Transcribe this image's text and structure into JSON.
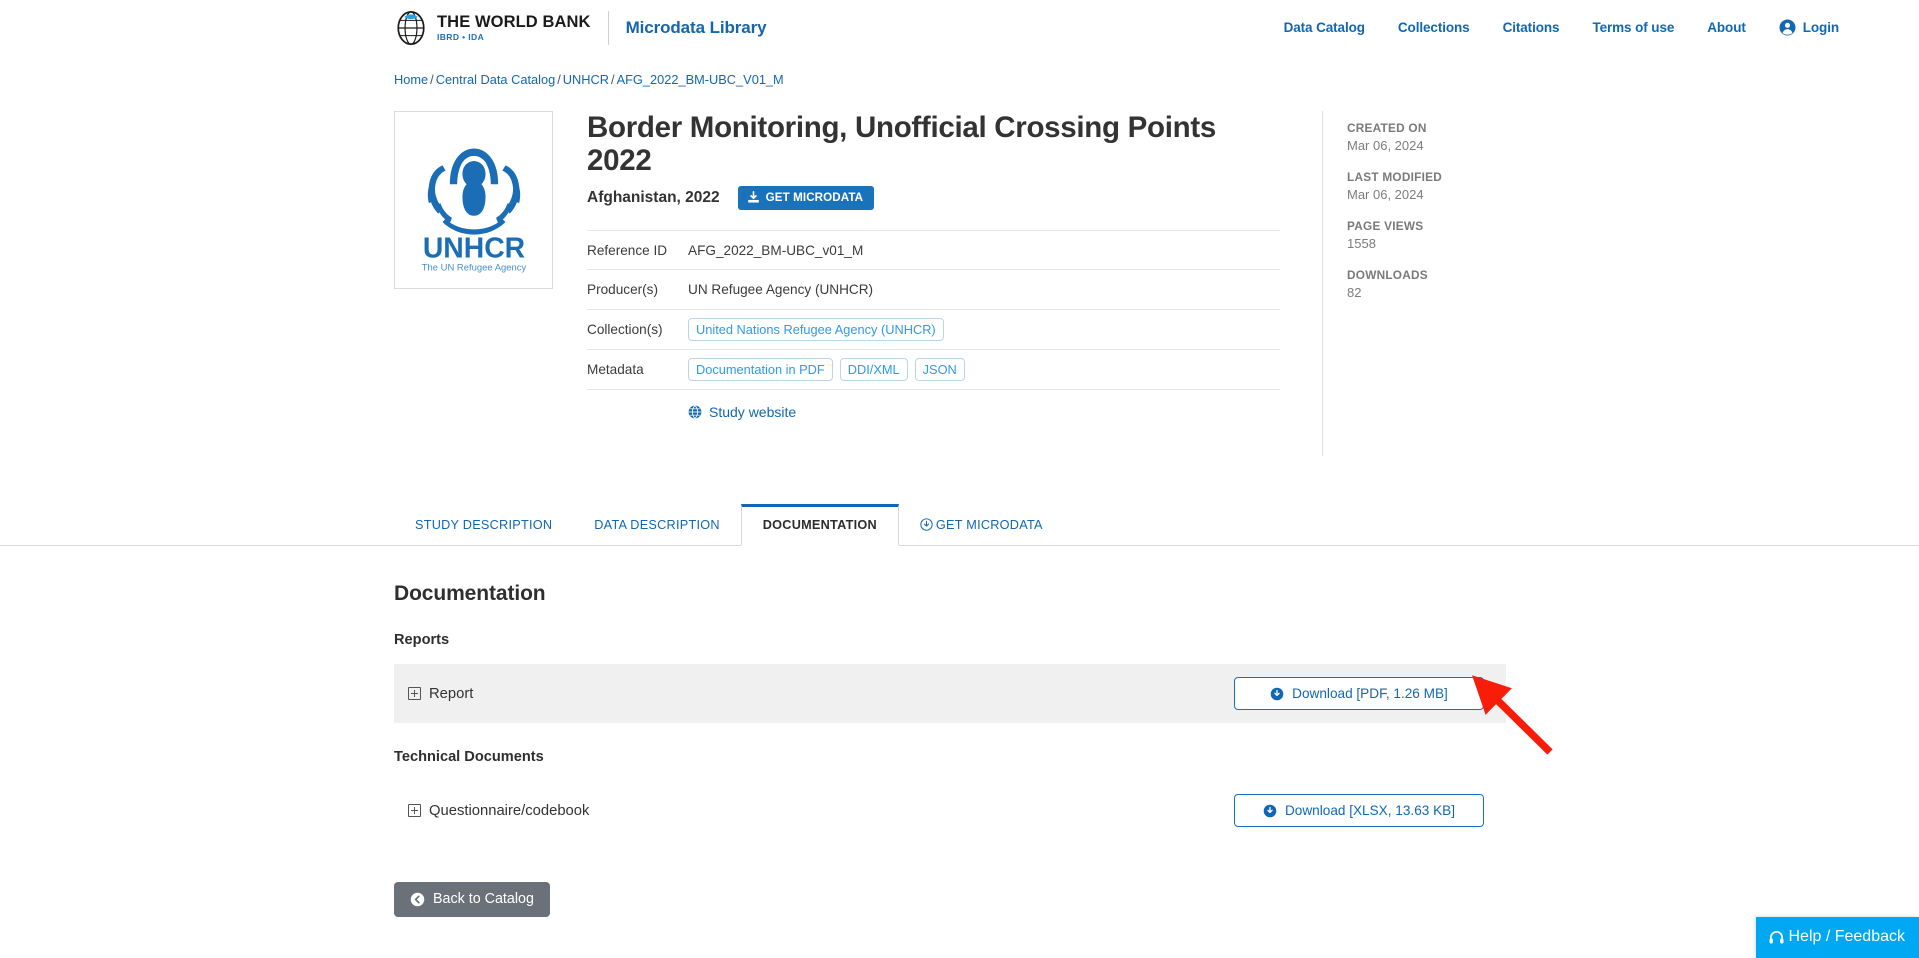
{
  "header": {
    "brand_title": "THE WORLD BANK",
    "brand_subtitle": "IBRD • IDA",
    "app_name": "Microdata Library",
    "nav": [
      {
        "label": "Data Catalog"
      },
      {
        "label": "Collections"
      },
      {
        "label": "Citations"
      },
      {
        "label": "Terms of use"
      },
      {
        "label": "About"
      }
    ],
    "login_label": "Login"
  },
  "breadcrumb": {
    "items": [
      {
        "label": "Home"
      },
      {
        "label": "Central Data Catalog"
      },
      {
        "label": "UNHCR"
      },
      {
        "label": "AFG_2022_BM-UBC_V01_M"
      }
    ],
    "separator": "/"
  },
  "study": {
    "logo_name": "UNHCR",
    "logo_tagline": "The UN Refugee Agency",
    "title": "Border Monitoring, Unofficial Crossing Points 2022",
    "country_year": "Afghanistan, 2022",
    "get_microdata_label": "GET MICRODATA",
    "metadata_rows": [
      {
        "label": "Reference ID",
        "type": "text",
        "value": "AFG_2022_BM-UBC_v01_M"
      },
      {
        "label": "Producer(s)",
        "type": "text",
        "value": "UN Refugee Agency (UNHCR)"
      },
      {
        "label": "Collection(s)",
        "type": "pills",
        "pills": [
          "United Nations Refugee Agency (UNHCR)"
        ]
      },
      {
        "label": "Metadata",
        "type": "pills",
        "pills": [
          "Documentation in PDF",
          "DDI/XML",
          "JSON"
        ]
      }
    ],
    "study_website_label": "Study website"
  },
  "stats": [
    {
      "label": "CREATED ON",
      "value": "Mar 06, 2024"
    },
    {
      "label": "LAST MODIFIED",
      "value": "Mar 06, 2024"
    },
    {
      "label": "PAGE VIEWS",
      "value": "1558"
    },
    {
      "label": "DOWNLOADS",
      "value": "82"
    }
  ],
  "tabs": [
    {
      "label": "STUDY DESCRIPTION",
      "active": false,
      "icon": ""
    },
    {
      "label": "DATA DESCRIPTION",
      "active": false,
      "icon": ""
    },
    {
      "label": "DOCUMENTATION",
      "active": true,
      "icon": ""
    },
    {
      "label": "GET MICRODATA",
      "active": false,
      "icon": "download-circle-icon"
    }
  ],
  "documentation": {
    "heading": "Documentation",
    "sections": [
      {
        "heading": "Reports",
        "shaded": true,
        "item_label": "Report",
        "download_label": "Download [PDF, 1.26 MB]"
      },
      {
        "heading": "Technical Documents",
        "shaded": false,
        "item_label": "Questionnaire/codebook",
        "download_label": "Download [XLSX, 13.63 KB]"
      }
    ],
    "back_label": "Back to Catalog"
  },
  "help_widget": {
    "label": "Help / Feedback"
  },
  "colors": {
    "brand_blue": "#1267b2",
    "button_blue": "#1a72bb",
    "pill_blue": "#3199e8",
    "help_blue": "#00a8f3",
    "back_gray": "#6a7179",
    "shaded_row": "#f0f0f0",
    "annotation_red": "#f81d08"
  },
  "annotation": {
    "type": "arrow",
    "color": "#f81d08",
    "points_to": "download-pdf-button"
  }
}
